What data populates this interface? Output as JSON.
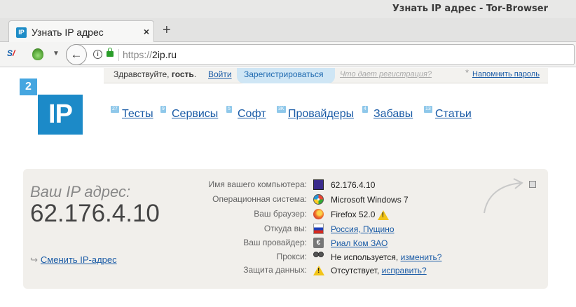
{
  "window": {
    "title": "Узнать IP адрес - Tor-Browser"
  },
  "tab": {
    "favicon": "IP",
    "title": "Узнать IP адрес",
    "close": "×",
    "new": "+"
  },
  "navbar": {
    "url_scheme": "https://",
    "url_host": "2ip.ru",
    "back": "←"
  },
  "topbar": {
    "greeting": "Здравствуйте, ",
    "guest": "гость",
    "dot": ".",
    "login": "Войти",
    "register": "Зарегистрироваться",
    "why": "Что дает регистрация?",
    "star": "*",
    "remind": "Напомнить пароль"
  },
  "logo": {
    "two": "2",
    "ip": "IP"
  },
  "menu": [
    {
      "badge": "27",
      "label": "Тесты"
    },
    {
      "badge": "9",
      "label": "Сервисы"
    },
    {
      "badge": "5",
      "label": "Софт"
    },
    {
      "badge": "3K",
      "label": "Провайдеры"
    },
    {
      "badge": "4",
      "label": "Забавы"
    },
    {
      "badge": "13",
      "label": "Статьи"
    }
  ],
  "card": {
    "ip_label": "Ваш IP адрес:",
    "ip_value": "62.176.4.10",
    "change_link": "Сменить IP-адрес",
    "rows": [
      {
        "label": "Имя вашего компьютера:",
        "icon": "monitor-icon",
        "value": "62.176.4.10"
      },
      {
        "label": "Операционная система:",
        "icon": "windows-icon",
        "value": "Microsoft Windows 7"
      },
      {
        "label": "Ваш браузер:",
        "icon": "firefox-icon",
        "value": "Firefox 52.0"
      },
      {
        "label": "Откуда вы:",
        "icon": "russia-flag-icon",
        "value": "Россия, Пущино"
      },
      {
        "label": "Ваш провайдер:",
        "icon": "isp-icon",
        "value": "Риал Ком ЗАО"
      },
      {
        "label": "Прокси:",
        "icon": "glasses-icon",
        "value": "Не используется, ",
        "link": "изменить?"
      },
      {
        "label": "Защита данных:",
        "icon": "warning-icon",
        "value": "Отсутствует, ",
        "link": "исправить?"
      }
    ]
  },
  "colors": {
    "accent": "#1c8ac8",
    "link": "#1a5ba6",
    "card_bg": "#f1efeb"
  }
}
